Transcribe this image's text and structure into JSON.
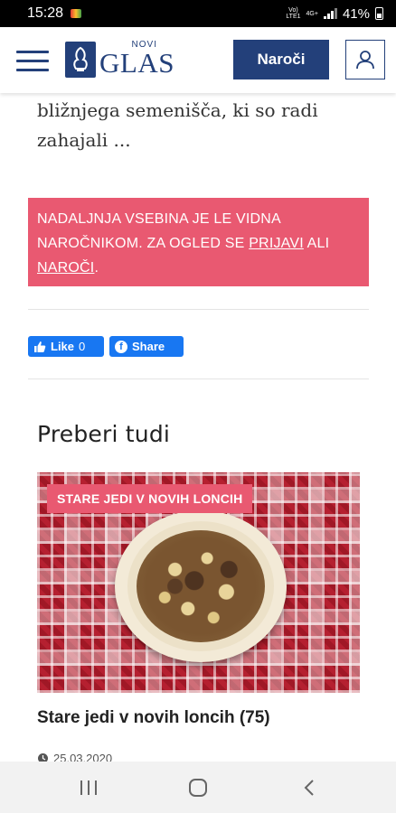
{
  "status_bar": {
    "time": "15:28",
    "network_top": "Vo)",
    "network_bottom": "LTE1",
    "network_type": "4G+",
    "battery": "41%"
  },
  "header": {
    "logo_small": "NOVI",
    "logo_large": "GLAS",
    "subscribe_label": "Naroči"
  },
  "article": {
    "excerpt": "bližnjega semenišča, ki so radi zahajali ..."
  },
  "paywall": {
    "text_before": "NADALJNJA VSEBINA JE LE VIDNA NAROČNIKOM. ZA OGLED SE ",
    "login_link": "PRIJAVI",
    "text_between": " ALI ",
    "subscribe_link": "NAROČI",
    "text_after": "."
  },
  "social": {
    "like_label": "Like",
    "like_count": "0",
    "share_label": "Share"
  },
  "related": {
    "section_title": "Preberi tudi",
    "card": {
      "tag": "STARE JEDI V NOVIH LONCIH",
      "title": "Stare jedi v novih loncih (75)",
      "date": "25.03.2020"
    }
  },
  "colors": {
    "brand_blue": "#23407a",
    "paywall_pink": "#e95971",
    "facebook_blue": "#1877f2"
  },
  "icons": [
    "menu-icon",
    "logo-emblem-icon",
    "user-icon",
    "thumbs-up-icon",
    "facebook-icon",
    "clock-icon",
    "recent-apps-icon",
    "home-icon",
    "back-icon"
  ]
}
